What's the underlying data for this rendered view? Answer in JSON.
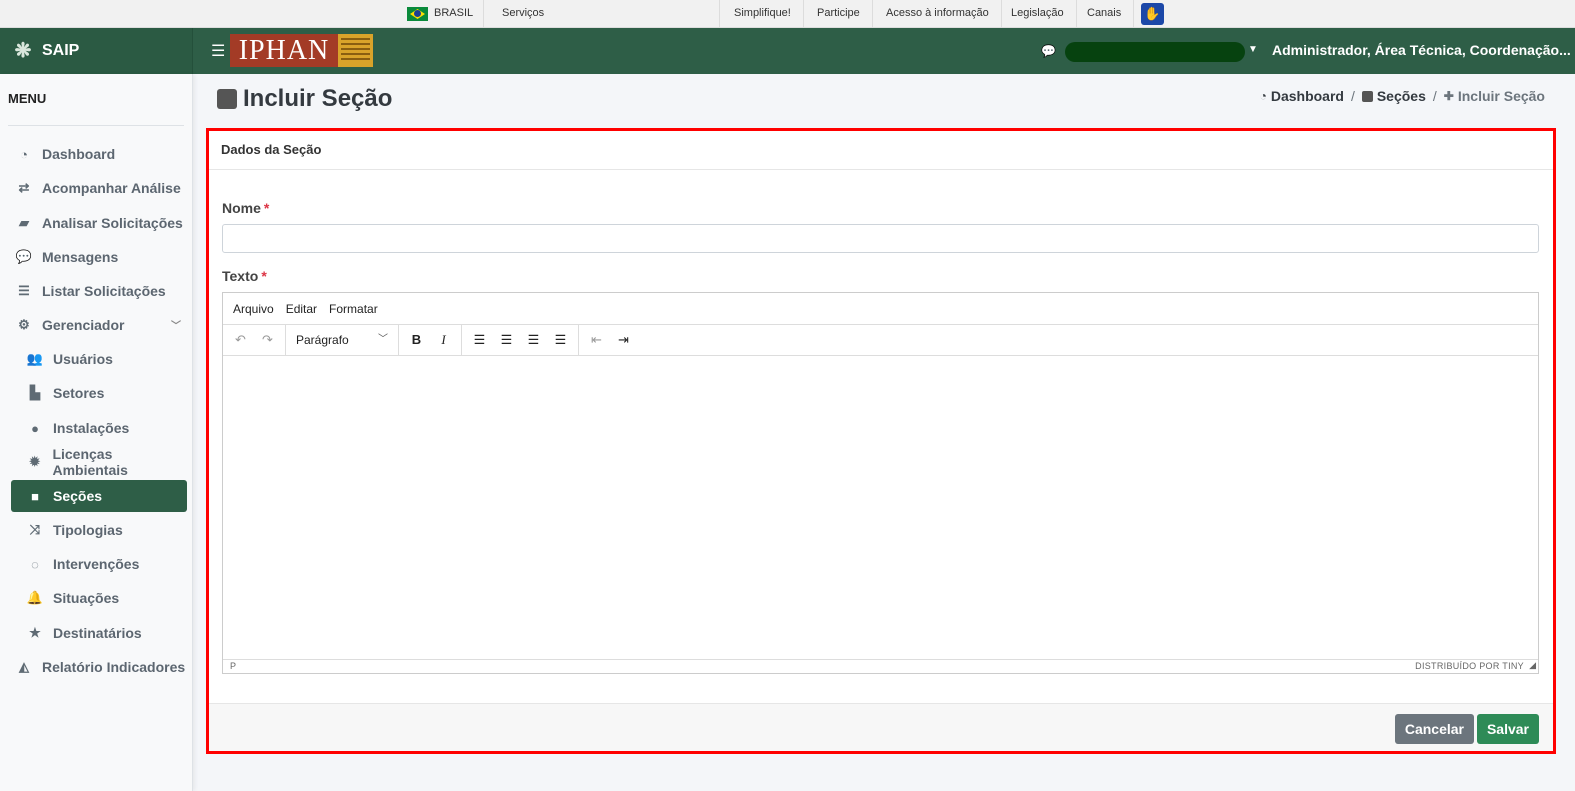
{
  "gov_bar": {
    "brasil": "BRASIL",
    "servicos": "Serviços",
    "links": [
      "Simplifique!",
      "Participe",
      "Acesso à informação",
      "Legislação",
      "Canais"
    ]
  },
  "brand": {
    "name": "SAIP"
  },
  "header": {
    "logo_text": "IPHAN",
    "user_name": "Administrador, Área Técnica, Coordenação..."
  },
  "sidebar": {
    "title": "MENU",
    "items": [
      {
        "label": "Dashboard",
        "icon": "dashboard-icon"
      },
      {
        "label": "Acompanhar Análise",
        "icon": "exchange-icon"
      },
      {
        "label": "Analisar Solicitações",
        "icon": "book-icon"
      },
      {
        "label": "Mensagens",
        "icon": "comments-icon"
      },
      {
        "label": "Listar Solicitações",
        "icon": "list-icon"
      },
      {
        "label": "Gerenciador",
        "icon": "cogs-icon"
      },
      {
        "label": "Usuários",
        "icon": "users-icon"
      },
      {
        "label": "Setores",
        "icon": "industry-icon"
      },
      {
        "label": "Instalações",
        "icon": "circle-icon"
      },
      {
        "label": "Licenças Ambientais",
        "icon": "certificate-icon"
      },
      {
        "label": "Seções",
        "icon": "square-icon"
      },
      {
        "label": "Tipologias",
        "icon": "random-icon"
      },
      {
        "label": "Intervenções",
        "icon": "circle-notch-icon"
      },
      {
        "label": "Situações",
        "icon": "bell-icon"
      },
      {
        "label": "Destinatários",
        "icon": "star-icon"
      },
      {
        "label": "Relatório Indicadores",
        "icon": "area-chart-icon"
      }
    ]
  },
  "page": {
    "title": "Incluir Seção",
    "breadcrumb": [
      "Dashboard",
      "Seções",
      "Incluir Seção"
    ]
  },
  "form": {
    "card_title": "Dados da Seção",
    "nome_label": "Nome",
    "nome_value": "",
    "texto_label": "Texto",
    "required_mark": "*",
    "editor": {
      "menu": [
        "Arquivo",
        "Editar",
        "Formatar"
      ],
      "block_format": "Parágrafo",
      "status_path": "P",
      "branding": "DISTRIBUÍDO POR TINY"
    },
    "cancel_label": "Cancelar",
    "save_label": "Salvar"
  },
  "colors": {
    "primary": "#2e5e47",
    "highlight_border": "#ff0000",
    "save_button": "#2e8b57",
    "cancel_button": "#6c757d"
  }
}
